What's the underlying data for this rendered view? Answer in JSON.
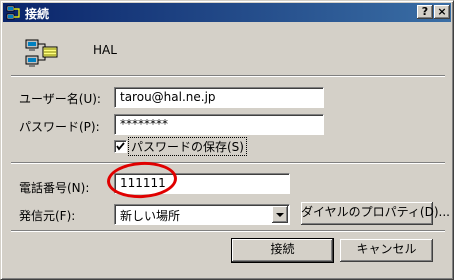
{
  "window": {
    "title": "接続",
    "help_label": "?",
    "close_label": "×"
  },
  "connection": {
    "name": "HAL",
    "icon": "network-computers-icon"
  },
  "fields": {
    "username_label": "ユーザー名(U):",
    "username_value": "tarou@hal.ne.jp",
    "password_label": "パスワード(P):",
    "password_value": "********",
    "save_password_label": "パスワードの保存(S)",
    "save_password_checked": true,
    "phone_label": "電話番号(N):",
    "phone_value": "111111",
    "dial_from_label": "発信元(F):",
    "dial_from_value": "新しい場所"
  },
  "buttons": {
    "dialing_properties": "ダイヤルのプロパティ(D)...",
    "connect": "接続",
    "cancel": "キャンセル"
  },
  "colors": {
    "titlebar_start": "#0a246a",
    "titlebar_end": "#3a6ea5",
    "face": "#d4d0c8",
    "annotation": "#e00000"
  }
}
